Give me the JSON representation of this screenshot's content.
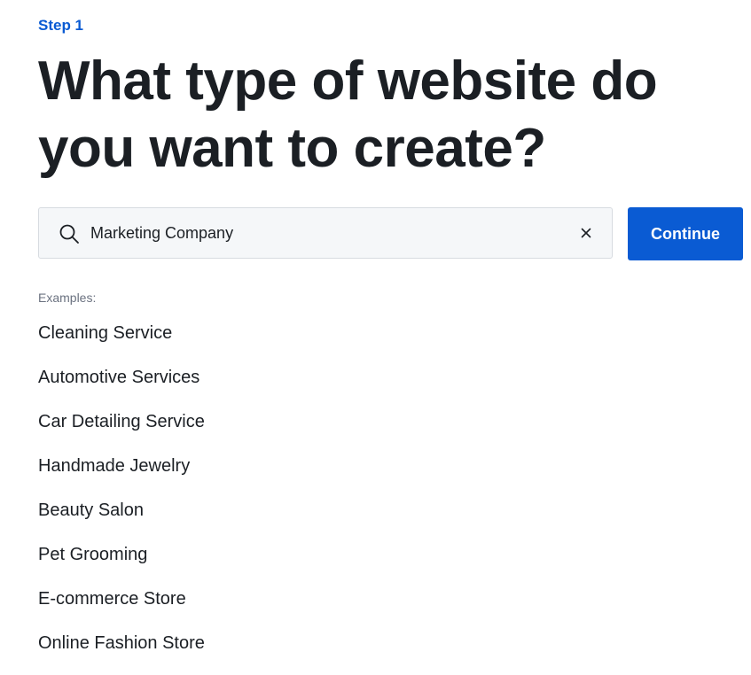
{
  "step": {
    "label": "Step 1"
  },
  "headline": "What type of website do you want to create?",
  "search": {
    "value": "Marketing Company",
    "icon": "search-icon",
    "clear_icon": "close-icon"
  },
  "continue_button": {
    "label": "Continue"
  },
  "examples": {
    "label": "Examples:",
    "items": [
      "Cleaning Service",
      "Automotive Services",
      "Car Detailing Service",
      "Handmade Jewelry",
      "Beauty Salon",
      "Pet Grooming",
      "E-commerce Store",
      "Online Fashion Store"
    ]
  },
  "colors": {
    "accent": "#0a5bd3",
    "text": "#1b1f24",
    "muted": "#6b7280",
    "input_bg": "#f5f7f9",
    "input_border": "#d7dbe0"
  }
}
